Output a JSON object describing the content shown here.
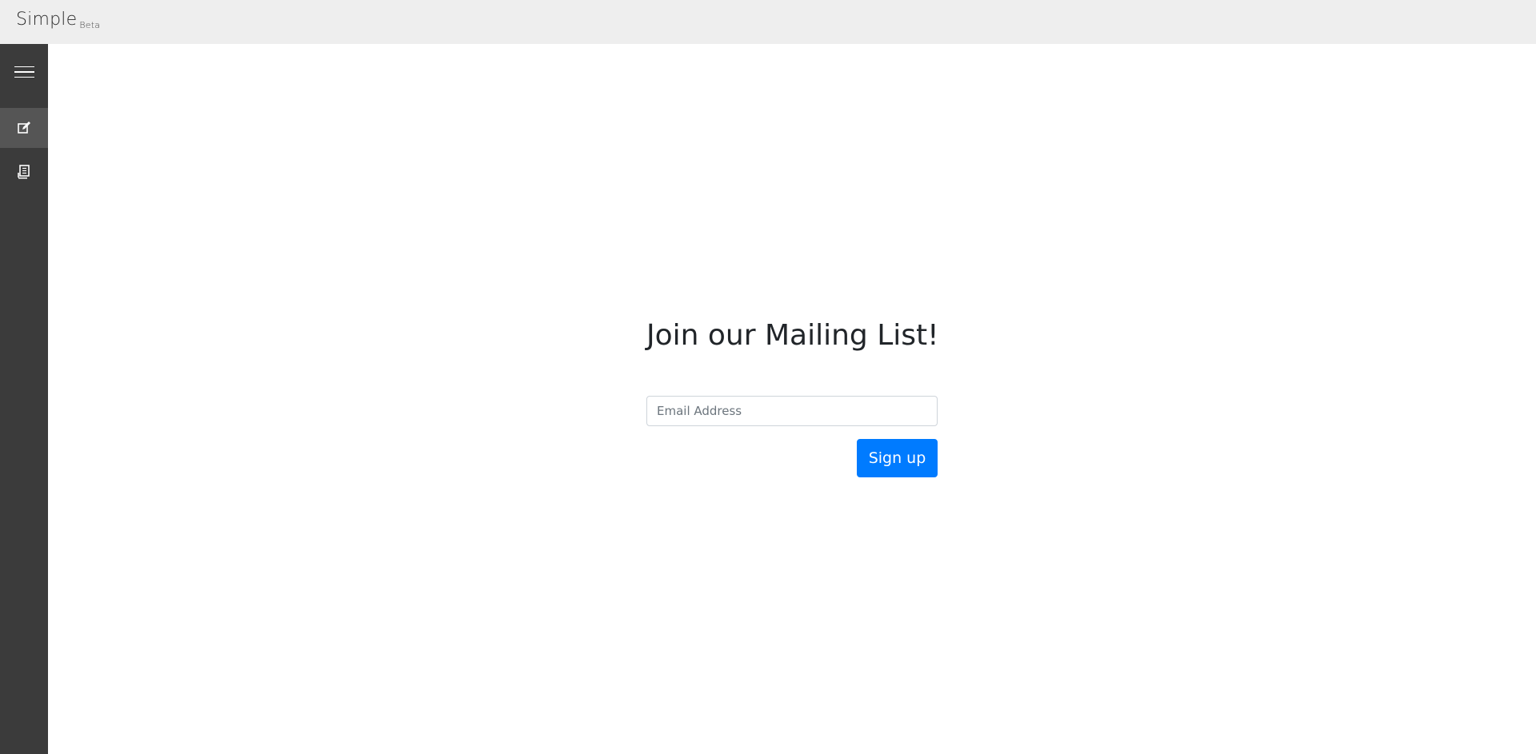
{
  "brand": {
    "name": "Simple",
    "badge": "Beta"
  },
  "sidebar": {
    "items": [
      {
        "icon": "hamburger-menu-icon"
      },
      {
        "icon": "edit-square-icon",
        "active": true
      },
      {
        "icon": "document-icon"
      }
    ]
  },
  "signup_form": {
    "heading": "Join our Mailing List!",
    "email_placeholder": "Email Address",
    "email_value": "",
    "button_label": "Sign up"
  },
  "colors": {
    "topbar_bg": "#eeeeee",
    "sidebar_bg": "#3b3b3b",
    "sidebar_active_bg": "#555555",
    "primary_button": "#007bff"
  }
}
